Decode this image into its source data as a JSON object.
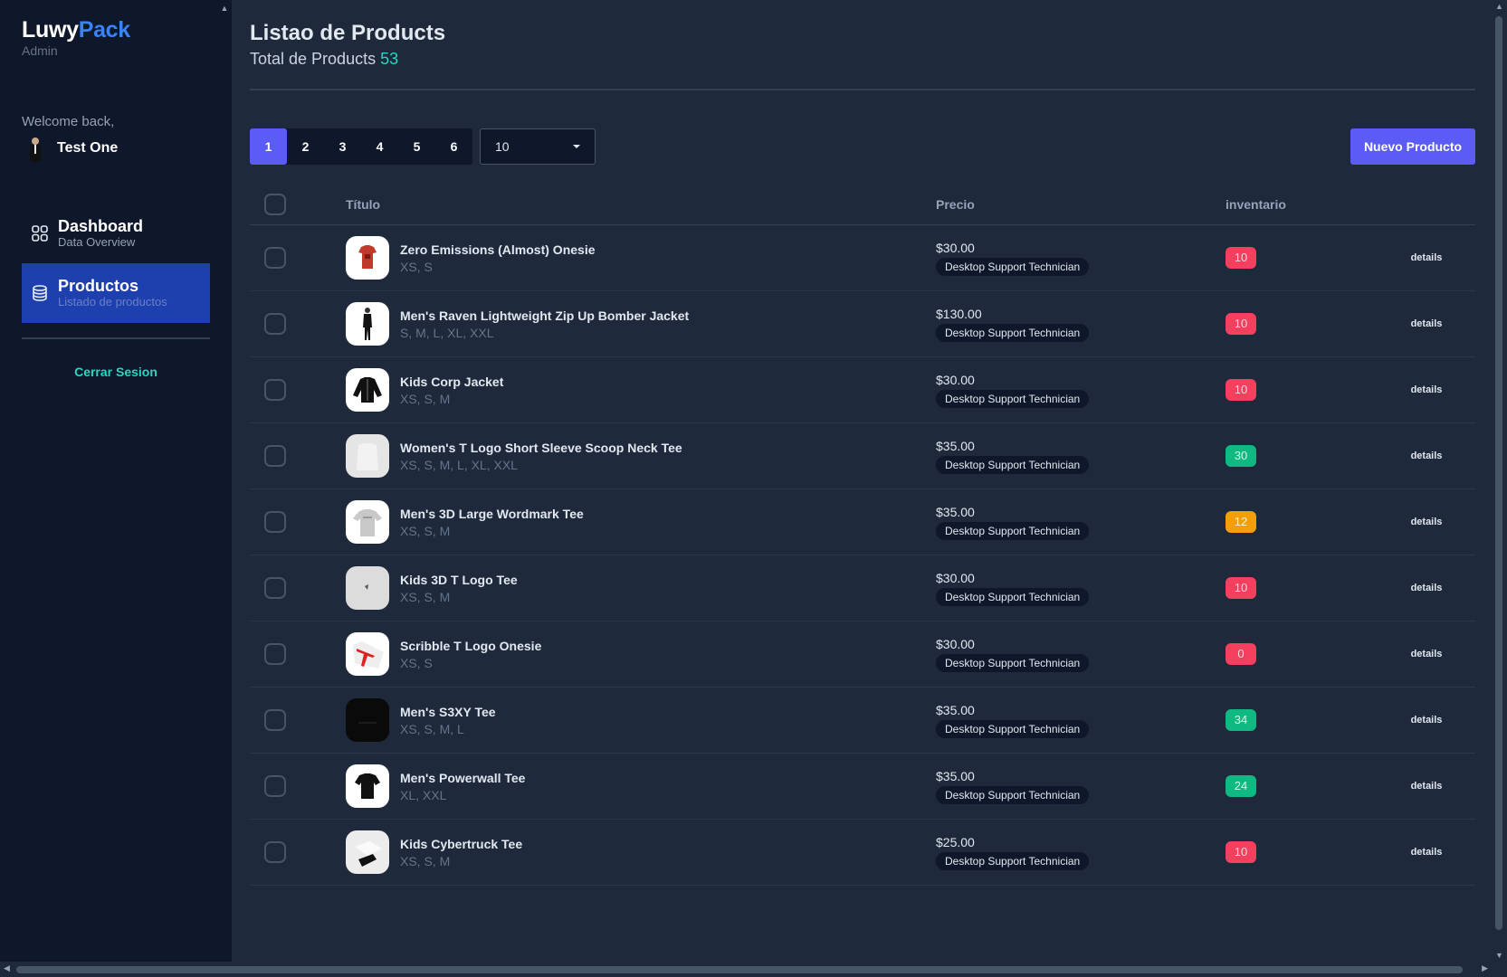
{
  "sidebar": {
    "brand_part1": "Luwy",
    "brand_part2": "Pack",
    "brand_sub": "Admin",
    "welcome": "Welcome back,",
    "user_name": "Test One",
    "nav": [
      {
        "title": "Dashboard",
        "sub": "Data Overview",
        "icon": "grid-icon",
        "active": false
      },
      {
        "title": "Productos",
        "sub": "Listado de productos",
        "icon": "database-icon",
        "active": true
      }
    ],
    "logout": "Cerrar Sesion"
  },
  "header": {
    "title": "Listao de Products",
    "subtitle_prefix": "Total de Products",
    "total": "53"
  },
  "toolbar": {
    "pages": [
      "1",
      "2",
      "3",
      "4",
      "5",
      "6"
    ],
    "active_page": "1",
    "per_page": "10",
    "new_button": "Nuevo Producto"
  },
  "table": {
    "headers": {
      "title": "Título",
      "price": "Precio",
      "stock": "inventario"
    },
    "rows": [
      {
        "name": "Zero Emissions (Almost) Onesie",
        "sizes": "XS, S",
        "price": "$30.00",
        "tag": "Desktop Support Technician",
        "stock": "10",
        "stock_color": "red",
        "details": "details"
      },
      {
        "name": "Men's Raven Lightweight Zip Up Bomber Jacket",
        "sizes": "S, M, L, XL, XXL",
        "price": "$130.00",
        "tag": "Desktop Support Technician",
        "stock": "10",
        "stock_color": "red",
        "details": "details"
      },
      {
        "name": "Kids Corp Jacket",
        "sizes": "XS, S, M",
        "price": "$30.00",
        "tag": "Desktop Support Technician",
        "stock": "10",
        "stock_color": "red",
        "details": "details"
      },
      {
        "name": "Women's T Logo Short Sleeve Scoop Neck Tee",
        "sizes": "XS, S, M, L, XL, XXL",
        "price": "$35.00",
        "tag": "Desktop Support Technician",
        "stock": "30",
        "stock_color": "green",
        "details": "details"
      },
      {
        "name": "Men's 3D Large Wordmark Tee",
        "sizes": "XS, S, M",
        "price": "$35.00",
        "tag": "Desktop Support Technician",
        "stock": "12",
        "stock_color": "yellow",
        "details": "details"
      },
      {
        "name": "Kids 3D T Logo Tee",
        "sizes": "XS, S, M",
        "price": "$30.00",
        "tag": "Desktop Support Technician",
        "stock": "10",
        "stock_color": "red",
        "details": "details"
      },
      {
        "name": "Scribble T Logo Onesie",
        "sizes": "XS, S",
        "price": "$30.00",
        "tag": "Desktop Support Technician",
        "stock": "0",
        "stock_color": "red",
        "details": "details"
      },
      {
        "name": "Men's S3XY Tee",
        "sizes": "XS, S, M, L",
        "price": "$35.00",
        "tag": "Desktop Support Technician",
        "stock": "34",
        "stock_color": "green",
        "details": "details"
      },
      {
        "name": "Men's Powerwall Tee",
        "sizes": "XL, XXL",
        "price": "$35.00",
        "tag": "Desktop Support Technician",
        "stock": "24",
        "stock_color": "green",
        "details": "details"
      },
      {
        "name": "Kids Cybertruck Tee",
        "sizes": "XS, S, M",
        "price": "$25.00",
        "tag": "Desktop Support Technician",
        "stock": "10",
        "stock_color": "red",
        "details": "details"
      }
    ]
  },
  "colors": {
    "accent": "#5b5bf6",
    "brand_blue": "#3b82f6",
    "teal": "#2dd4bf",
    "sidebar_active": "#1e40af"
  }
}
